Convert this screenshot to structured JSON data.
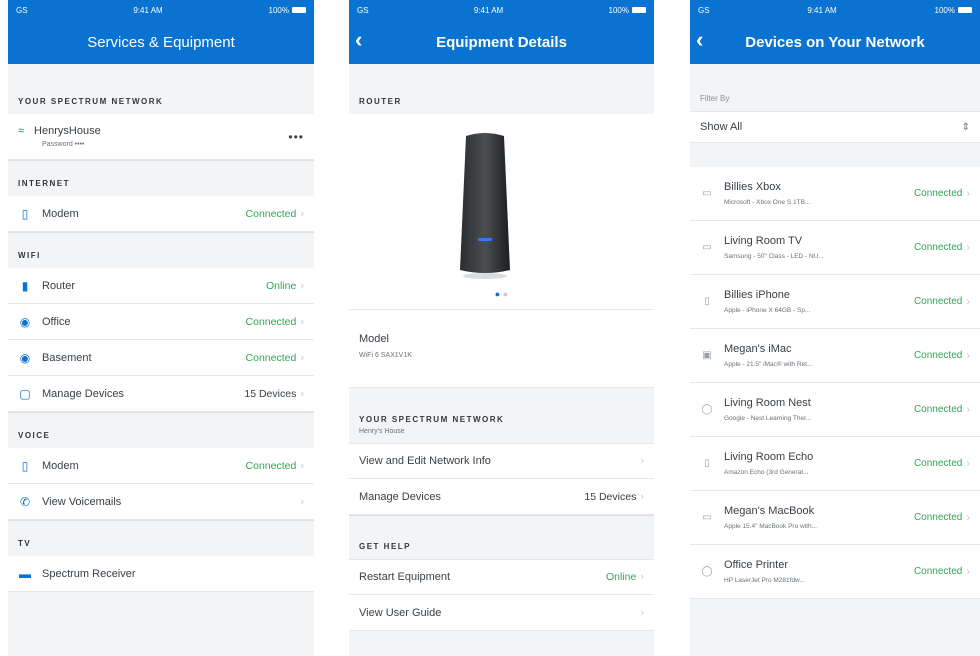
{
  "colors": {
    "brand": "#0a72d1",
    "connected": "#2fa84f"
  },
  "status_bar": {
    "carrier": "GS",
    "time": "9:41 AM",
    "battery": "100%"
  },
  "screen1": {
    "title": "Services & Equipment",
    "network_header": "YOUR SPECTRUM NETWORK",
    "network_name": "HenrysHouse",
    "network_password": "Password ••••",
    "internet_header": "INTERNET",
    "internet_modem": {
      "label": "Modem",
      "status": "Connected"
    },
    "wifi_header": "WIFI",
    "wifi_items": [
      {
        "icon": "router-icon",
        "label": "Router",
        "status": "Online"
      },
      {
        "icon": "extender-icon",
        "label": "Office",
        "status": "Connected"
      },
      {
        "icon": "extender-icon",
        "label": "Basement",
        "status": "Connected"
      },
      {
        "icon": "device-icon",
        "label": "Manage Devices",
        "status": "15 Devices"
      }
    ],
    "voice_header": "VOICE",
    "voice_modem": {
      "label": "Modem",
      "status": "Connected"
    },
    "voicemail_label": "View Voicemails",
    "tv_header": "TV",
    "tv_receiver_label": "Spectrum Receiver"
  },
  "screen2": {
    "title": "Equipment Details",
    "router_header": "ROUTER",
    "model_label": "Model",
    "model_value": "WiFi 6 SAX1V1K",
    "network_header": "YOUR SPECTRUM NETWORK",
    "network_sub": "Henry's House",
    "view_edit_label": "View and Edit Network Info",
    "manage_label": "Manage Devices",
    "manage_value": "15 Devices",
    "help_header": "GET HELP",
    "restart_label": "Restart Equipment",
    "restart_status": "Online",
    "guide_label": "View User Guide"
  },
  "screen3": {
    "title": "Devices on Your Network",
    "filter_label": "Filter By",
    "filter_value": "Show All",
    "devices": [
      {
        "icon": "console-icon",
        "name": "Billies Xbox",
        "desc": "Microsoft - Xbox One S 1TB...",
        "status": "Connected"
      },
      {
        "icon": "tv-icon",
        "name": "Living Room TV",
        "desc": "Samsung - 50\" Class - LED - NU...",
        "status": "Connected"
      },
      {
        "icon": "phone-icon",
        "name": "Billies iPhone",
        "desc": "Apple - iPhone X 64GB - Sp...",
        "status": "Connected"
      },
      {
        "icon": "desktop-icon",
        "name": "Megan's iMac",
        "desc": "Apple - 21.5\" iMac® with Ret...",
        "status": "Connected"
      },
      {
        "icon": "thermostat-icon",
        "name": "Living Room Nest",
        "desc": "Google - Nest Learning Ther...",
        "status": "Connected"
      },
      {
        "icon": "speaker-icon",
        "name": "Living Room Echo",
        "desc": "Amazon Echo (3rd Generat...",
        "status": "Connected"
      },
      {
        "icon": "laptop-icon",
        "name": "Megan's MacBook",
        "desc": "Apple 15.4\" MacBook Pro with...",
        "status": "Connected"
      },
      {
        "icon": "printer-icon",
        "name": "Office Printer",
        "desc": "HP LaserJet Pro M281fdw...",
        "status": "Connected"
      }
    ]
  }
}
